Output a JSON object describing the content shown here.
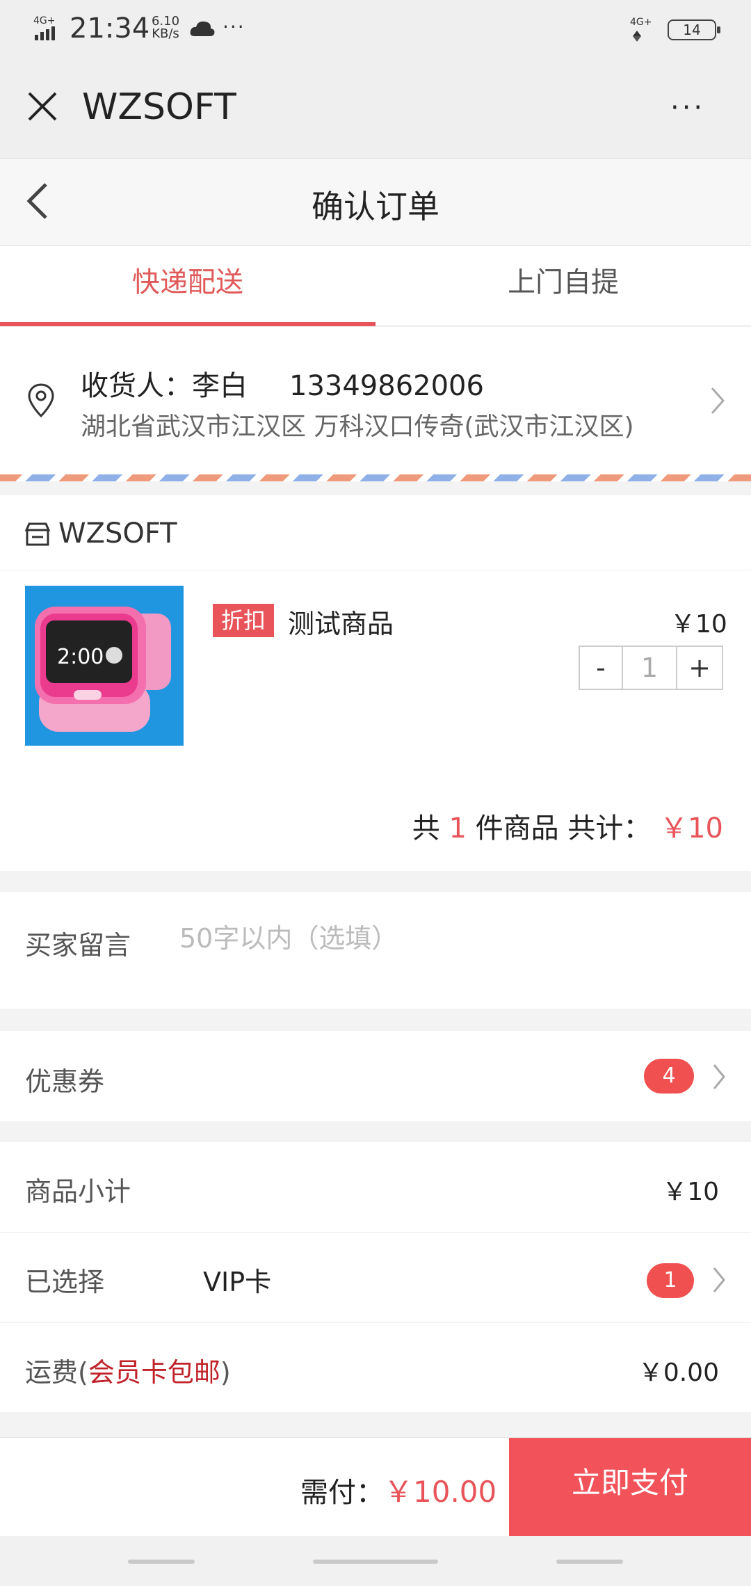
{
  "status_bar": {
    "network": "4G+",
    "time": "21:34",
    "speed_value": "6.10",
    "speed_unit": "KB/s",
    "dots": "···",
    "network2": "4G+",
    "battery": "14"
  },
  "titlebar": {
    "title": "WZSOFT",
    "more": "···"
  },
  "page": {
    "title": "确认订单"
  },
  "tabs": [
    {
      "label": "快递配送"
    },
    {
      "label": "上门自提"
    }
  ],
  "address": {
    "receiver_label": "收货人：李白",
    "phone": "13349862006",
    "detail": "湖北省武汉市江汉区 万科汉口传奇(武汉市江汉区)"
  },
  "shop": {
    "name": "WZSOFT",
    "product": {
      "tag": "折扣",
      "name": "测试商品",
      "price": "￥10",
      "quantity": "1",
      "minus": "-",
      "plus": "+"
    },
    "summary": {
      "prefix": "共",
      "count": "1",
      "middle": "件商品 共计：",
      "total": "￥10"
    }
  },
  "message": {
    "label": "买家留言",
    "placeholder": "50字以内（选填）"
  },
  "coupon": {
    "label": "优惠券",
    "count": "4"
  },
  "summary": {
    "subtotal_label": "商品小计",
    "subtotal_value": "￥10",
    "selected_label": "已选择",
    "selected_item": "VIP卡",
    "selected_count": "1",
    "shipping_label": "运费(",
    "shipping_note": "会员卡包邮",
    "shipping_close": ")",
    "shipping_value": "￥0.00"
  },
  "bottom": {
    "need_label": "需付：",
    "amount": "￥10.00",
    "pay_button": "立即支付"
  },
  "colors": {
    "accent": "#e8545a",
    "pay_button": "#f2525a",
    "thumb_bg": "#2196e0"
  }
}
